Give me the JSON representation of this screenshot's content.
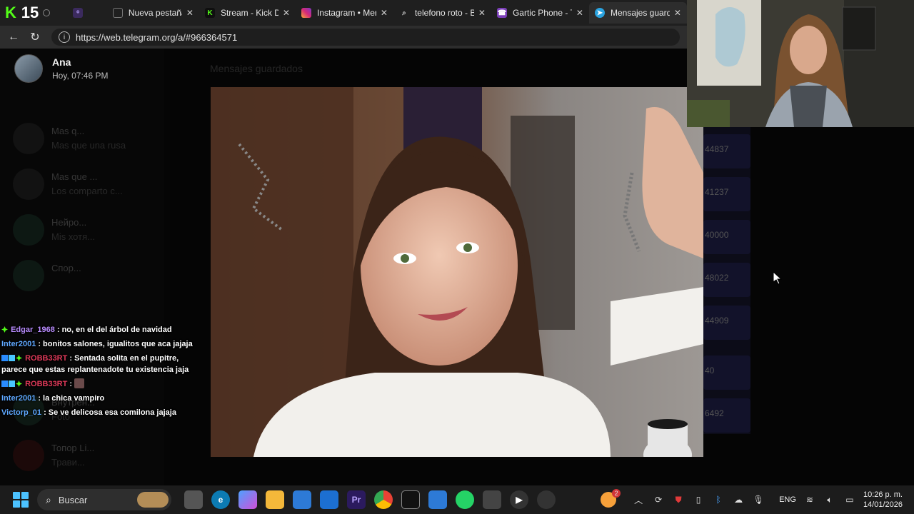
{
  "browser": {
    "stream_count": "15",
    "tabs": [
      {
        "title": "",
        "favicon": "twitch-icon",
        "active": false
      },
      {
        "title": "Nueva pestaña",
        "favicon": "newtab-icon",
        "active": false
      },
      {
        "title": "Stream - Kick Dash",
        "favicon": "kick-icon",
        "active": false
      },
      {
        "title": "Instagram • Mensa",
        "favicon": "instagram-icon",
        "active": false
      },
      {
        "title": "telefono roto - Bús",
        "favicon": "search-icon",
        "active": false
      },
      {
        "title": "Gartic Phone - Tele",
        "favicon": "gartic-icon",
        "active": false
      },
      {
        "title": "Mensajes guardad",
        "favicon": "telegram-icon",
        "active": true
      }
    ],
    "url": "https://web.telegram.org/a/#966364571"
  },
  "viewer": {
    "sender_name": "Ana",
    "timestamp": "Hoy, 07:46 PM",
    "background_chat_title": "Mensajes guardados"
  },
  "sidebar_ghost": [
    {
      "title": "Mas q...",
      "snippet": "Mas que una rusa"
    },
    {
      "title": "Mas que ...",
      "snippet": "Los comparto c..."
    },
    {
      "title": "Нейро...",
      "snippet": "Mis хотя..."
    },
    {
      "title": "Спор...",
      "snippet": ""
    },
    {
      "title": "Внутрен...",
      "snippet": "Foto"
    },
    {
      "title": "Топор Li...",
      "snippet": "Трави..."
    }
  ],
  "right_ghost": [
    "44837",
    "41237",
    "40000",
    "48022",
    "44909",
    "40",
    "6492"
  ],
  "stream_chat": [
    {
      "user": "Edgar_1968",
      "user_color": "#b98cff",
      "message": "no, en el del árbol de navidad",
      "badges": [
        "gift-badge"
      ]
    },
    {
      "user": "Inter2001",
      "user_color": "#5fa8ff",
      "message": "bonitos salones, igualitos que aca jajaja",
      "badges": []
    },
    {
      "user": "ROBB33RT",
      "user_color": "#e03a5a",
      "message": "Sentada solita en el pupitre, parece que estas replantenadote tu existencia jaja",
      "badges": [
        "kick-badge",
        "sub-badge",
        "gift-badge"
      ]
    },
    {
      "user": "ROBB33RT",
      "user_color": "#e03a5a",
      "message": "",
      "badges": [
        "kick-badge",
        "sub-badge",
        "gift-badge"
      ],
      "emote": "emote-icon"
    },
    {
      "user": "Inter2001",
      "user_color": "#5fa8ff",
      "message": "la chica vampiro",
      "badges": []
    },
    {
      "user": "Victorp_01",
      "user_color": "#5fa8ff",
      "message": "Se ve delicosa esa comilona jajaja",
      "badges": []
    }
  ],
  "taskbar": {
    "search_label": "Buscar",
    "language": "ENG",
    "time": "10:26 p. m.",
    "date": "14/01/2026",
    "notification_count": "2"
  }
}
